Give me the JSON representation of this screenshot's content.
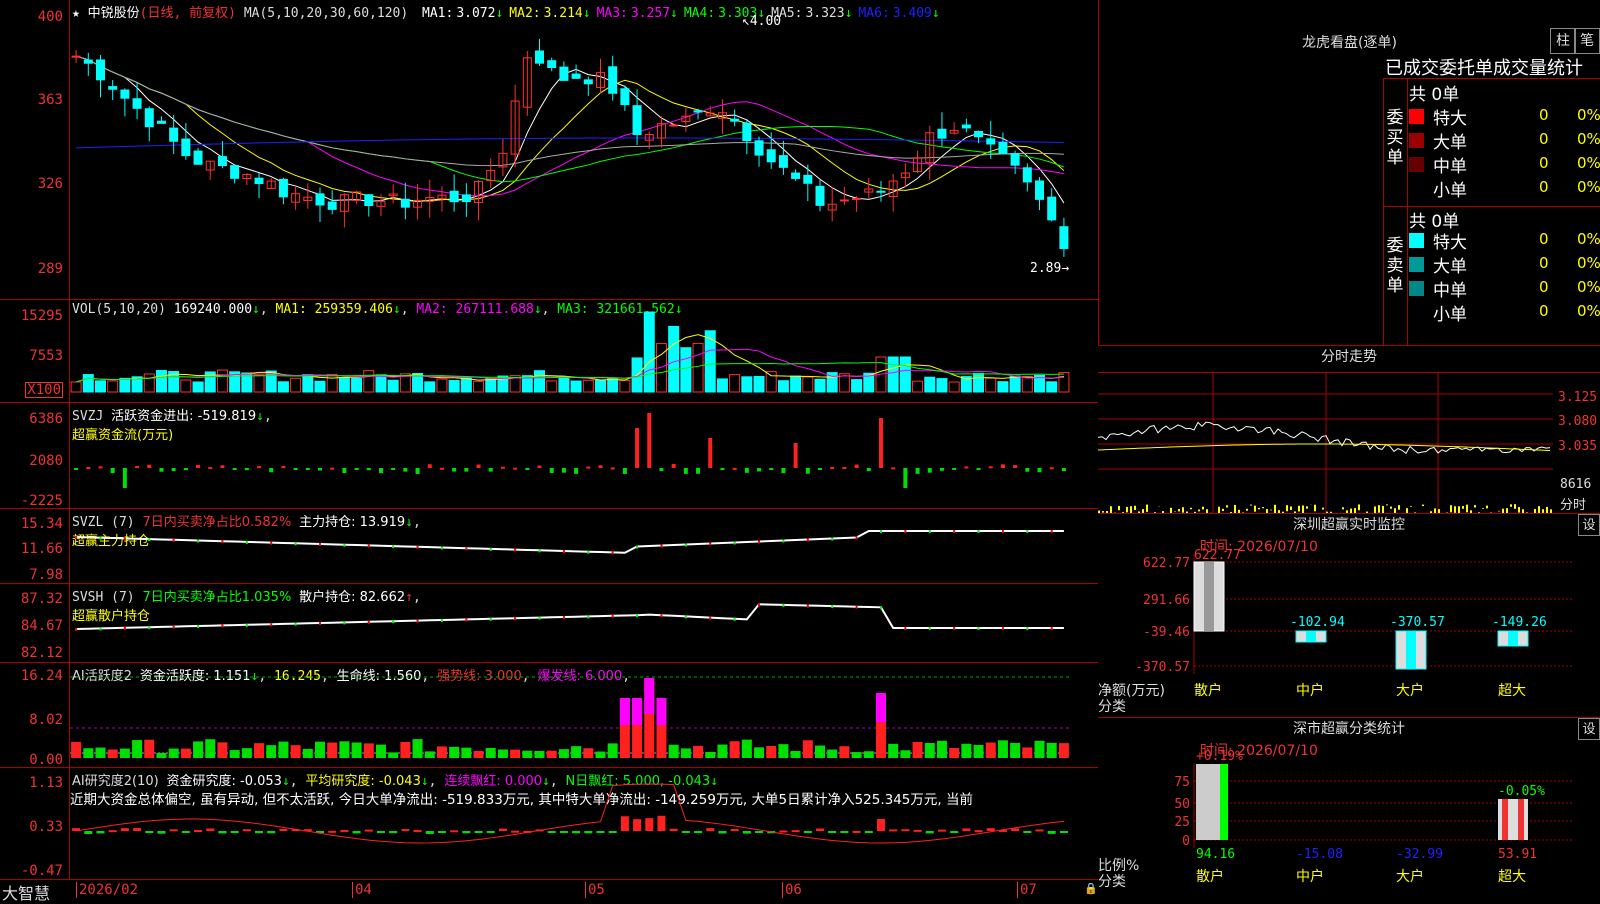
{
  "main": {
    "stock_title": "中锐股份",
    "mode": "(日线, 前复权)",
    "ma_label": "MA(5,10,20,30,60,120)",
    "ma_values": [
      {
        "name": "MA1:",
        "value": "3.072",
        "arrow": "↓",
        "color": "#ffffff"
      },
      {
        "name": "MA2:",
        "value": "3.214",
        "arrow": "↓",
        "color": "#ffff00"
      },
      {
        "name": "MA3:",
        "value": "3.257",
        "arrow": "↓",
        "color": "#ff00ff"
      },
      {
        "name": "MA4:",
        "value": "3.303",
        "arrow": "↓",
        "color": "#00ff00"
      },
      {
        "name": "MA5:",
        "value": "3.323",
        "arrow": "↓",
        "color": "#dddddd"
      },
      {
        "name": "MA6:",
        "value": "3.409",
        "arrow": "↓",
        "color": "#2020ff"
      }
    ],
    "y_labels": [
      "400",
      "363",
      "326",
      "289"
    ],
    "high_marker": "4.00",
    "low_marker": "2.89",
    "cursor_glyphs": "+ * + * +"
  },
  "vol": {
    "label": "VOL(5,10,20)",
    "value": "169240.000",
    "ma1": "MA1: 259359.406",
    "ma2": "MA2: 267111.688",
    "ma3": "MA3: 321661.562",
    "y_labels": [
      "15295",
      "7553"
    ],
    "unit": "X100"
  },
  "svzj": {
    "label": "SVZJ",
    "line1": "活跃资金进出: -519.819",
    "line2": "超赢资金流(万元)",
    "y_labels": [
      "6386",
      "2080",
      "-2225"
    ]
  },
  "svzl": {
    "label": "SVZL (7)",
    "ratio": "7日内买卖净占比0.582%",
    "hold": "主力持仓: 13.919",
    "line2": "超赢主力持仓",
    "y_labels": [
      "15.34",
      "11.66",
      "7.98"
    ]
  },
  "svsh": {
    "label": "SVSH (7)",
    "ratio": "7日内买卖净占比1.035%",
    "hold": "散户持仓: 82.662",
    "line2": "超赢散户持仓",
    "y_labels": [
      "87.32",
      "84.67",
      "82.12"
    ]
  },
  "ai_active": {
    "label": "AI活跃度2",
    "active": "资金活跃度: 1.151",
    "v2": "16.245",
    "life": "生命线: 1.560",
    "strong": "强势线: 3.000",
    "burst": "爆发线: 6.000",
    "y_labels": [
      "16.24",
      "8.02",
      "0.00"
    ]
  },
  "ai_research": {
    "label": "AI研究度2(10)",
    "research": "资金研究度: -0.053",
    "avg": "平均研究度: -0.043",
    "cont": "连续飘红: 0.000",
    "nday": "N日飘红: 5.000, -0.043",
    "comment": "近期大资金总体偏空, 虽有异动, 但不太活跃, 今日大单净流出: -519.833万元, 其中特大单净流出: -149.259万元, 大单5日累计净入525.345万元, 当前",
    "y_labels": [
      "1.13",
      "0.33",
      "-0.47"
    ]
  },
  "xaxis": {
    "brand": "大智慧",
    "labels": [
      "2026/02",
      "04",
      "05",
      "06",
      "07"
    ]
  },
  "dragon": {
    "title": "龙虎看盘(逐单)",
    "btn1": "柱",
    "btn2": "笔",
    "subtitle": "已成交委托单成交量统计",
    "buy_title": "共 0单",
    "sell_title": "共 0单",
    "buy_side": "委买单",
    "sell_side": "委卖单",
    "buy_rows": [
      {
        "label": "特大",
        "value": "0",
        "pct": "0%",
        "color": "#ff0000"
      },
      {
        "label": "大单",
        "value": "0",
        "pct": "0%",
        "color": "#990000"
      },
      {
        "label": "中单",
        "value": "0",
        "pct": "0%",
        "color": "#660000"
      },
      {
        "label": "小单",
        "value": "0",
        "pct": "0%",
        "color": "#000000"
      }
    ],
    "sell_rows": [
      {
        "label": "特大",
        "value": "0",
        "pct": "0%",
        "color": "#00ffff"
      },
      {
        "label": "大单",
        "value": "0",
        "pct": "0%",
        "color": "#009999"
      },
      {
        "label": "中单",
        "value": "0",
        "pct": "0%",
        "color": "#008888"
      },
      {
        "label": "小单",
        "value": "0",
        "pct": "0%",
        "color": "#000000"
      }
    ]
  },
  "intraday": {
    "title": "分时走势",
    "prices": [
      "3.125",
      "3.080",
      "3.035"
    ],
    "vol_label": "8616",
    "vol_unit": "分时"
  },
  "monitor": {
    "title": "深圳超赢实时监控",
    "setting": "设",
    "time": "时间: 2026/07/10",
    "y_labels": [
      "622.77",
      "291.66",
      "-39.46",
      "-370.57"
    ],
    "ylab_title": "净额(万元)",
    "cat_title": "分类",
    "categories": [
      "散户",
      "中户",
      "大户",
      "超大"
    ],
    "values": [
      "622.77",
      "-102.94",
      "-370.57",
      "-149.26"
    ]
  },
  "classify": {
    "title": "深市超赢分类统计",
    "setting": "设",
    "time": "时间: 2026/07/10",
    "y_labels": [
      "75",
      "50",
      "25",
      "0"
    ],
    "ylab_title": "比例%",
    "cat_title": "分类",
    "categories": [
      "散户",
      "中户",
      "大户",
      "超大"
    ],
    "values": [
      "94.16",
      "-15.08",
      "-32.99",
      "53.91"
    ],
    "top_labels": [
      "+0.19%",
      "-0.05%"
    ]
  }
}
